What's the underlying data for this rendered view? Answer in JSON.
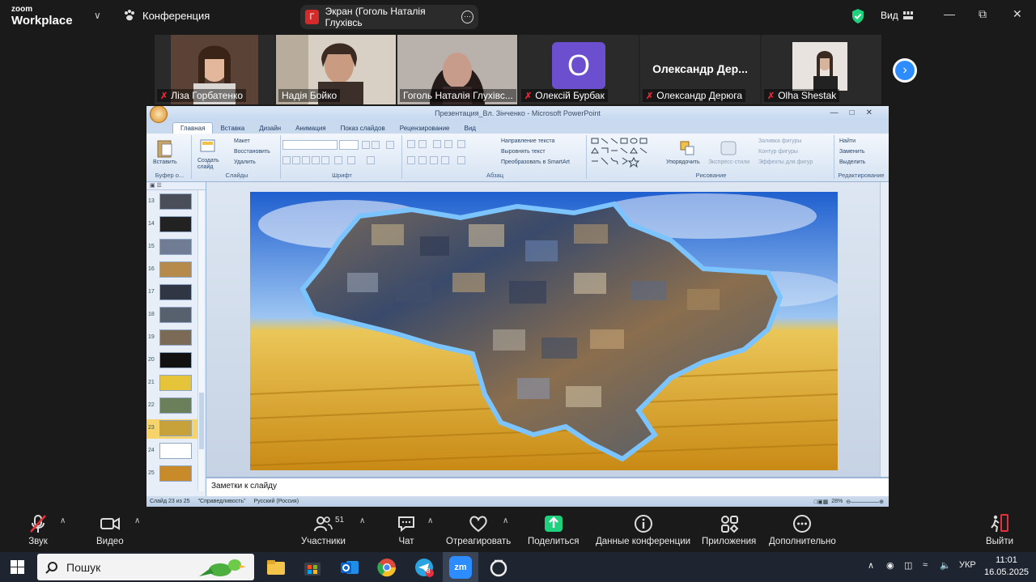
{
  "zoom": {
    "logo_line1": "zoom",
    "logo_line2": "Workplace",
    "meeting_label": "Конференция",
    "share_indicator_initial": "Г",
    "share_indicator_text": "Экран (Гоголь Наталія Глухівсь",
    "view_label": "Вид",
    "accent_green": "#1fd07c",
    "accent_blue": "#2d8cff"
  },
  "participants": [
    {
      "name": "Ліза Горбатенко",
      "muted": true
    },
    {
      "name": "Надія Бойко",
      "muted": false
    },
    {
      "name": "Гоголь Наталія Глухівс...",
      "muted": false,
      "active": true
    },
    {
      "name": "Олексій Бурбак",
      "muted": true,
      "avatar_letter": "О"
    },
    {
      "name": "Олександр Дерюга",
      "muted": true,
      "big_name": "Олександр  Дер..."
    },
    {
      "name": "Olha Shestak",
      "muted": true
    }
  ],
  "powerpoint": {
    "title": "Презентация_Вл. Зінченко - Microsoft PowerPoint",
    "tabs": [
      "Главная",
      "Вставка",
      "Дизайн",
      "Анимация",
      "Показ слайдов",
      "Рецензирование",
      "Вид"
    ],
    "ribbon": {
      "paste": "Вставить",
      "clipboard_group": "Буфер о...",
      "new_slide": "Создать слайд",
      "layout": "Макет",
      "reset": "Восстановить",
      "delete": "Удалить",
      "slides_group": "Слайды",
      "font_group": "Шрифт",
      "text_direction": "Направление текста",
      "align_text": "Выровнять текст",
      "smartart": "Преобразовать в SmartArt",
      "paragraph_group": "Абзац",
      "arrange": "Упорядочить",
      "quick_styles": "Экспресс-стили",
      "shape_fill": "Заливка фигуры",
      "shape_outline": "Контур фигуры",
      "shape_effects": "Эффекты для фигур",
      "drawing_group": "Рисование",
      "find": "Найти",
      "replace": "Заменить",
      "select": "Выделить",
      "editing_group": "Редактирование"
    },
    "slide_numbers": [
      "13",
      "14",
      "15",
      "16",
      "17",
      "18",
      "19",
      "20",
      "21",
      "22",
      "23",
      "24",
      "25"
    ],
    "selected_slide": "23",
    "notes_placeholder": "Заметки к слайду",
    "status": {
      "slide_count": "Слайд 23 из 25",
      "theme": "\"Справедливость\"",
      "language": "Русский (Россия)",
      "zoom": "28%"
    }
  },
  "toolbar": {
    "audio": "Звук",
    "video": "Видео",
    "participants": "Участники",
    "participants_count": "51",
    "chat": "Чат",
    "react": "Отреагировать",
    "share": "Поделиться",
    "meeting_info": "Данные конференции",
    "apps": "Приложения",
    "more": "Дополнительно",
    "leave": "Выйти"
  },
  "taskbar": {
    "search_placeholder": "Пошук",
    "language": "УКР",
    "time": "11:01",
    "date": "16.05.2025",
    "telegram_badge": "8",
    "zoom_app_label": "zm"
  }
}
